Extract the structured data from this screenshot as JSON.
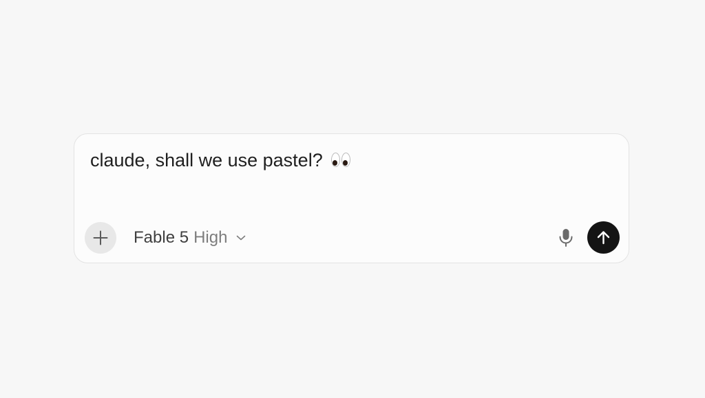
{
  "composer": {
    "message": "claude, shall we use pastel?",
    "emoji": "👀"
  },
  "toolbar": {
    "attach_icon": "plus-icon",
    "model_name": "Fable 5",
    "effort_level": "High",
    "model_dropdown_icon": "chevron-down-icon",
    "voice_icon": "microphone-icon",
    "send_icon": "arrow-up-icon"
  },
  "colors": {
    "page_background": "#f7f7f7",
    "composer_background": "#fcfcfc",
    "send_button": "#141414",
    "plus_button": "#e8e8e8"
  }
}
